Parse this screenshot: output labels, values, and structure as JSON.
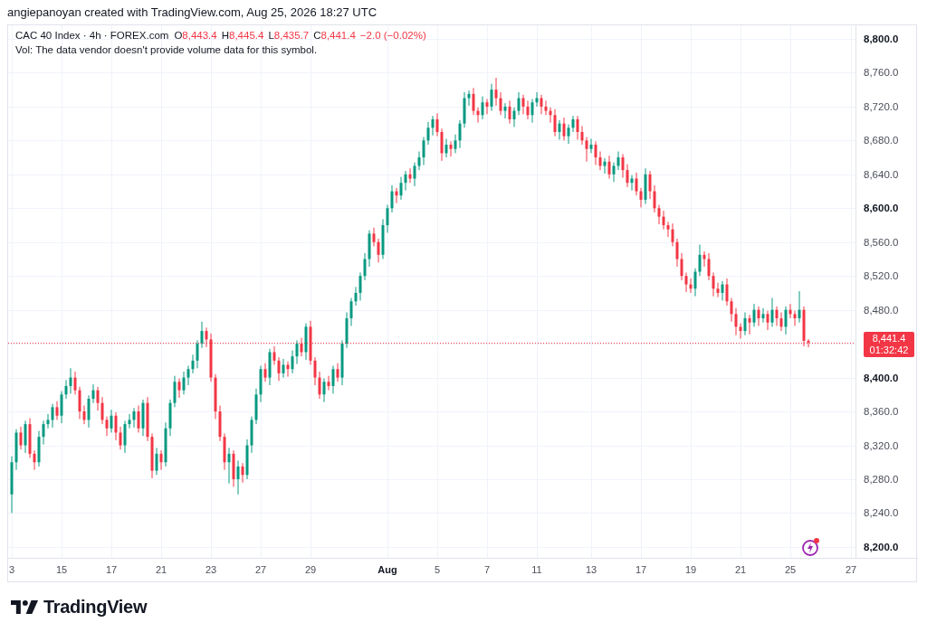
{
  "header": {
    "text": "angiepanoyan created with TradingView.com, Aug 25, 2026 18:27 UTC"
  },
  "legend": {
    "symbol": "CAC 40 Index · 4h · FOREX.com",
    "values": [
      {
        "label": "O",
        "value": "8,443.4"
      },
      {
        "label": "H",
        "value": "8,445.4"
      },
      {
        "label": "L",
        "value": "8,435.7"
      },
      {
        "label": "C",
        "value": "8,441.4"
      }
    ],
    "change": "−2.0 (−0.02%)",
    "volume_note": "Vol: The data vendor doesn't provide volume data for this symbol."
  },
  "chart_data": {
    "type": "candlestick",
    "categories": [
      "3",
      null,
      null,
      null,
      null,
      null,
      null,
      null,
      null,
      null,
      null,
      "15",
      null,
      null,
      null,
      null,
      null,
      null,
      null,
      null,
      null,
      null,
      "17",
      null,
      null,
      null,
      null,
      null,
      null,
      null,
      null,
      null,
      null,
      "21",
      null,
      null,
      null,
      null,
      null,
      null,
      null,
      null,
      null,
      null,
      "23",
      null,
      null,
      null,
      null,
      null,
      null,
      null,
      null,
      null,
      null,
      "27",
      null,
      null,
      null,
      null,
      null,
      null,
      null,
      null,
      null,
      null,
      "29",
      null,
      null,
      null,
      null,
      null,
      null,
      null,
      null,
      null,
      null,
      null,
      null,
      null,
      null,
      null,
      null,
      "Aug",
      null,
      null,
      null,
      null,
      null,
      null,
      null,
      null,
      null,
      null,
      "5",
      null,
      null,
      null,
      null,
      null,
      null,
      null,
      null,
      null,
      null,
      "7",
      null,
      null,
      null,
      null,
      null,
      null,
      null,
      null,
      null,
      null,
      "11",
      null,
      null,
      null,
      null,
      null,
      null,
      null,
      null,
      null,
      null,
      null,
      "13",
      null,
      null,
      null,
      null,
      null,
      null,
      null,
      null,
      null,
      null,
      "17",
      null,
      null,
      null,
      null,
      null,
      null,
      null,
      null,
      null,
      null,
      "19",
      null,
      null,
      null,
      null,
      null,
      null,
      null,
      null,
      null,
      null,
      "21",
      null,
      null,
      null,
      null,
      null,
      null,
      null,
      null,
      null,
      null,
      "25",
      null,
      null,
      null,
      null
    ],
    "ohlc": [
      [
        8262,
        8307,
        8240,
        8300
      ],
      [
        8300,
        8339,
        8291,
        8335
      ],
      [
        8335,
        8342,
        8315,
        8320
      ],
      [
        8320,
        8349,
        8311,
        8345
      ],
      [
        8345,
        8352,
        8305,
        8310
      ],
      [
        8310,
        8314,
        8291,
        8300
      ],
      [
        8300,
        8337,
        8295,
        8330
      ],
      [
        8330,
        8349,
        8321,
        8345
      ],
      [
        8345,
        8357,
        8340,
        8350
      ],
      [
        8350,
        8369,
        8341,
        8365
      ],
      [
        8365,
        8372,
        8350,
        8355
      ],
      [
        8355,
        8384,
        8346,
        8380
      ],
      [
        8380,
        8397,
        8375,
        8390
      ],
      [
        8390,
        8411,
        8381,
        8400
      ],
      [
        8400,
        8407,
        8380,
        8385
      ],
      [
        8385,
        8389,
        8351,
        8360
      ],
      [
        8360,
        8367,
        8345,
        8350
      ],
      [
        8350,
        8379,
        8341,
        8375
      ],
      [
        8375,
        8392,
        8370,
        8385
      ],
      [
        8385,
        8389,
        8361,
        8370
      ],
      [
        8370,
        8377,
        8345,
        8350
      ],
      [
        8350,
        8354,
        8331,
        8340
      ],
      [
        8340,
        8362,
        8335,
        8355
      ],
      [
        8355,
        8359,
        8326,
        8335
      ],
      [
        8335,
        8342,
        8315,
        8320
      ],
      [
        8320,
        8349,
        8311,
        8345
      ],
      [
        8345,
        8357,
        8340,
        8350
      ],
      [
        8350,
        8364,
        8341,
        8360
      ],
      [
        8360,
        8367,
        8335,
        8340
      ],
      [
        8340,
        8374,
        8331,
        8370
      ],
      [
        8370,
        8377,
        8325,
        8330
      ],
      [
        8330,
        8334,
        8281,
        8290
      ],
      [
        8290,
        8317,
        8285,
        8310
      ],
      [
        8310,
        8314,
        8291,
        8300
      ],
      [
        8300,
        8347,
        8295,
        8340
      ],
      [
        8340,
        8374,
        8331,
        8370
      ],
      [
        8370,
        8402,
        8365,
        8395
      ],
      [
        8395,
        8399,
        8376,
        8385
      ],
      [
        8385,
        8407,
        8380,
        8400
      ],
      [
        8400,
        8414,
        8391,
        8410
      ],
      [
        8410,
        8427,
        8405,
        8420
      ],
      [
        8420,
        8444,
        8411,
        8440
      ],
      [
        8440,
        8466,
        8435,
        8455
      ],
      [
        8455,
        8459,
        8436,
        8445
      ],
      [
        8445,
        8452,
        8395,
        8400
      ],
      [
        8400,
        8404,
        8351,
        8360
      ],
      [
        8360,
        8367,
        8325,
        8330
      ],
      [
        8330,
        8334,
        8291,
        8300
      ],
      [
        8300,
        8317,
        8275,
        8310
      ],
      [
        8310,
        8314,
        8271,
        8280
      ],
      [
        8280,
        8302,
        8262,
        8295
      ],
      [
        8295,
        8299,
        8276,
        8285
      ],
      [
        8285,
        8327,
        8280,
        8320
      ],
      [
        8320,
        8354,
        8311,
        8350
      ],
      [
        8350,
        8387,
        8345,
        8380
      ],
      [
        8380,
        8414,
        8371,
        8410
      ],
      [
        8410,
        8417,
        8395,
        8400
      ],
      [
        8400,
        8434,
        8391,
        8430
      ],
      [
        8430,
        8437,
        8415,
        8420
      ],
      [
        8420,
        8424,
        8396,
        8405
      ],
      [
        8405,
        8422,
        8400,
        8415
      ],
      [
        8415,
        8419,
        8401,
        8410
      ],
      [
        8410,
        8432,
        8405,
        8425
      ],
      [
        8425,
        8444,
        8416,
        8440
      ],
      [
        8440,
        8447,
        8425,
        8430
      ],
      [
        8430,
        8464,
        8421,
        8460
      ],
      [
        8460,
        8467,
        8415,
        8420
      ],
      [
        8420,
        8424,
        8391,
        8400
      ],
      [
        8400,
        8407,
        8375,
        8380
      ],
      [
        8380,
        8399,
        8371,
        8395
      ],
      [
        8395,
        8402,
        8385,
        8390
      ],
      [
        8390,
        8414,
        8381,
        8410
      ],
      [
        8410,
        8417,
        8395,
        8400
      ],
      [
        8400,
        8444,
        8391,
        8440
      ],
      [
        8440,
        8477,
        8435,
        8470
      ],
      [
        8470,
        8494,
        8461,
        8490
      ],
      [
        8490,
        8507,
        8485,
        8500
      ],
      [
        8500,
        8524,
        8491,
        8520
      ],
      [
        8520,
        8547,
        8515,
        8540
      ],
      [
        8540,
        8574,
        8531,
        8570
      ],
      [
        8570,
        8577,
        8555,
        8560
      ],
      [
        8560,
        8564,
        8536,
        8545
      ],
      [
        8545,
        8587,
        8540,
        8580
      ],
      [
        8580,
        8604,
        8571,
        8600
      ],
      [
        8600,
        8627,
        8595,
        8620
      ],
      [
        8620,
        8624,
        8606,
        8615
      ],
      [
        8615,
        8637,
        8610,
        8630
      ],
      [
        8630,
        8644,
        8621,
        8640
      ],
      [
        8640,
        8647,
        8630,
        8635
      ],
      [
        8635,
        8654,
        8626,
        8650
      ],
      [
        8650,
        8667,
        8645,
        8660
      ],
      [
        8660,
        8684,
        8651,
        8680
      ],
      [
        8680,
        8702,
        8675,
        8695
      ],
      [
        8695,
        8709,
        8686,
        8705
      ],
      [
        8705,
        8712,
        8685,
        8690
      ],
      [
        8690,
        8694,
        8656,
        8665
      ],
      [
        8665,
        8682,
        8660,
        8675
      ],
      [
        8675,
        8679,
        8661,
        8670
      ],
      [
        8670,
        8687,
        8665,
        8680
      ],
      [
        8680,
        8704,
        8671,
        8700
      ],
      [
        8700,
        8737,
        8695,
        8730
      ],
      [
        8730,
        8739,
        8721,
        8735
      ],
      [
        8735,
        8742,
        8710,
        8715
      ],
      [
        8715,
        8719,
        8701,
        8710
      ],
      [
        8710,
        8732,
        8705,
        8725
      ],
      [
        8725,
        8729,
        8711,
        8720
      ],
      [
        8720,
        8747,
        8715,
        8740
      ],
      [
        8740,
        8754,
        8721,
        8730
      ],
      [
        8730,
        8737,
        8710,
        8715
      ],
      [
        8715,
        8724,
        8706,
        8720
      ],
      [
        8720,
        8727,
        8700,
        8705
      ],
      [
        8705,
        8719,
        8696,
        8715
      ],
      [
        8715,
        8737,
        8710,
        8730
      ],
      [
        8730,
        8734,
        8711,
        8720
      ],
      [
        8720,
        8727,
        8705,
        8710
      ],
      [
        8710,
        8729,
        8701,
        8725
      ],
      [
        8725,
        8737,
        8720,
        8730
      ],
      [
        8730,
        8734,
        8711,
        8720
      ],
      [
        8720,
        8727,
        8710,
        8715
      ],
      [
        8715,
        8719,
        8701,
        8710
      ],
      [
        8710,
        8717,
        8685,
        8690
      ],
      [
        8690,
        8704,
        8681,
        8700
      ],
      [
        8700,
        8707,
        8680,
        8685
      ],
      [
        8685,
        8699,
        8676,
        8695
      ],
      [
        8695,
        8709,
        8690,
        8705
      ],
      [
        8705,
        8709,
        8681,
        8690
      ],
      [
        8690,
        8697,
        8675,
        8680
      ],
      [
        8680,
        8684,
        8655,
        8670
      ],
      [
        8670,
        8682,
        8665,
        8675
      ],
      [
        8675,
        8679,
        8651,
        8660
      ],
      [
        8660,
        8667,
        8645,
        8650
      ],
      [
        8650,
        8659,
        8641,
        8655
      ],
      [
        8655,
        8662,
        8635,
        8640
      ],
      [
        8640,
        8654,
        8631,
        8650
      ],
      [
        8650,
        8667,
        8645,
        8660
      ],
      [
        8660,
        8664,
        8636,
        8645
      ],
      [
        8645,
        8652,
        8625,
        8630
      ],
      [
        8630,
        8639,
        8621,
        8635
      ],
      [
        8635,
        8642,
        8615,
        8620
      ],
      [
        8620,
        8624,
        8601,
        8610
      ],
      [
        8610,
        8647,
        8605,
        8640
      ],
      [
        8640,
        8644,
        8611,
        8620
      ],
      [
        8620,
        8627,
        8595,
        8600
      ],
      [
        8600,
        8604,
        8581,
        8590
      ],
      [
        8590,
        8597,
        8575,
        8580
      ],
      [
        8580,
        8584,
        8566,
        8575
      ],
      [
        8575,
        8582,
        8555,
        8560
      ],
      [
        8560,
        8564,
        8531,
        8540
      ],
      [
        8540,
        8547,
        8515,
        8520
      ],
      [
        8520,
        8524,
        8501,
        8510
      ],
      [
        8510,
        8517,
        8500,
        8505
      ],
      [
        8505,
        8529,
        8496,
        8525
      ],
      [
        8525,
        8557,
        8520,
        8545
      ],
      [
        8545,
        8549,
        8531,
        8540
      ],
      [
        8540,
        8547,
        8515,
        8520
      ],
      [
        8520,
        8524,
        8496,
        8505
      ],
      [
        8505,
        8512,
        8495,
        8500
      ],
      [
        8500,
        8514,
        8491,
        8510
      ],
      [
        8510,
        8517,
        8485,
        8490
      ],
      [
        8490,
        8494,
        8466,
        8475
      ],
      [
        8475,
        8482,
        8450,
        8460
      ],
      [
        8460,
        8464,
        8446,
        8455
      ],
      [
        8455,
        8477,
        8450,
        8470
      ],
      [
        8470,
        8474,
        8451,
        8465
      ],
      [
        8465,
        8487,
        8460,
        8480
      ],
      [
        8480,
        8484,
        8461,
        8470
      ],
      [
        8470,
        8482,
        8465,
        8475
      ],
      [
        8475,
        8479,
        8456,
        8465
      ],
      [
        8465,
        8494,
        8460,
        8480
      ],
      [
        8480,
        8484,
        8461,
        8470
      ],
      [
        8470,
        8477,
        8455,
        8460
      ],
      [
        8460,
        8484,
        8451,
        8480
      ],
      [
        8480,
        8487,
        8470,
        8475
      ],
      [
        8475,
        8479,
        8461,
        8470
      ],
      [
        8470,
        8502,
        8465,
        8480
      ],
      [
        8480,
        8484,
        8437,
        8443.4
      ],
      [
        8443.4,
        8445.4,
        8435.7,
        8441.4
      ]
    ],
    "ylim": [
      8186,
      8816
    ],
    "grid": true,
    "ref_lines": [
      {
        "axis": "y",
        "value": 8441.4,
        "color": "#f23645"
      }
    ],
    "yticks": [
      {
        "value": 8800,
        "label": "8,800.0"
      },
      {
        "value": 8760,
        "label": "8,760.0"
      },
      {
        "value": 8720,
        "label": "8,720.0"
      },
      {
        "value": 8680,
        "label": "8,680.0"
      },
      {
        "value": 8640,
        "label": "8,640.0"
      },
      {
        "value": 8600,
        "label": "8,600.0"
      },
      {
        "value": 8560,
        "label": "8,560.0"
      },
      {
        "value": 8520,
        "label": "8,520.0"
      },
      {
        "value": 8480,
        "label": "8,480.0"
      },
      {
        "value": 8400,
        "label": "8,400.0"
      },
      {
        "value": 8360,
        "label": "8,360.0"
      },
      {
        "value": 8320,
        "label": "8,320.0"
      },
      {
        "value": 8280,
        "label": "8,280.0"
      },
      {
        "value": 8240,
        "label": "8,240.0"
      },
      {
        "value": 8200,
        "label": "8,200.0"
      }
    ]
  },
  "price_axis": {
    "tick_bold": [
      true,
      false,
      false,
      false,
      false,
      true,
      false,
      false,
      false,
      true,
      false,
      false,
      false,
      false,
      true
    ],
    "last_price": "8,441.4",
    "countdown": "01:32:42"
  },
  "time_axis": {
    "tick_bold": [
      false,
      false,
      false,
      false,
      false,
      false,
      false,
      true,
      false,
      false,
      false,
      false,
      false,
      false,
      false,
      false,
      false
    ],
    "end_label": "27"
  },
  "brand": {
    "name": "TradingView"
  }
}
